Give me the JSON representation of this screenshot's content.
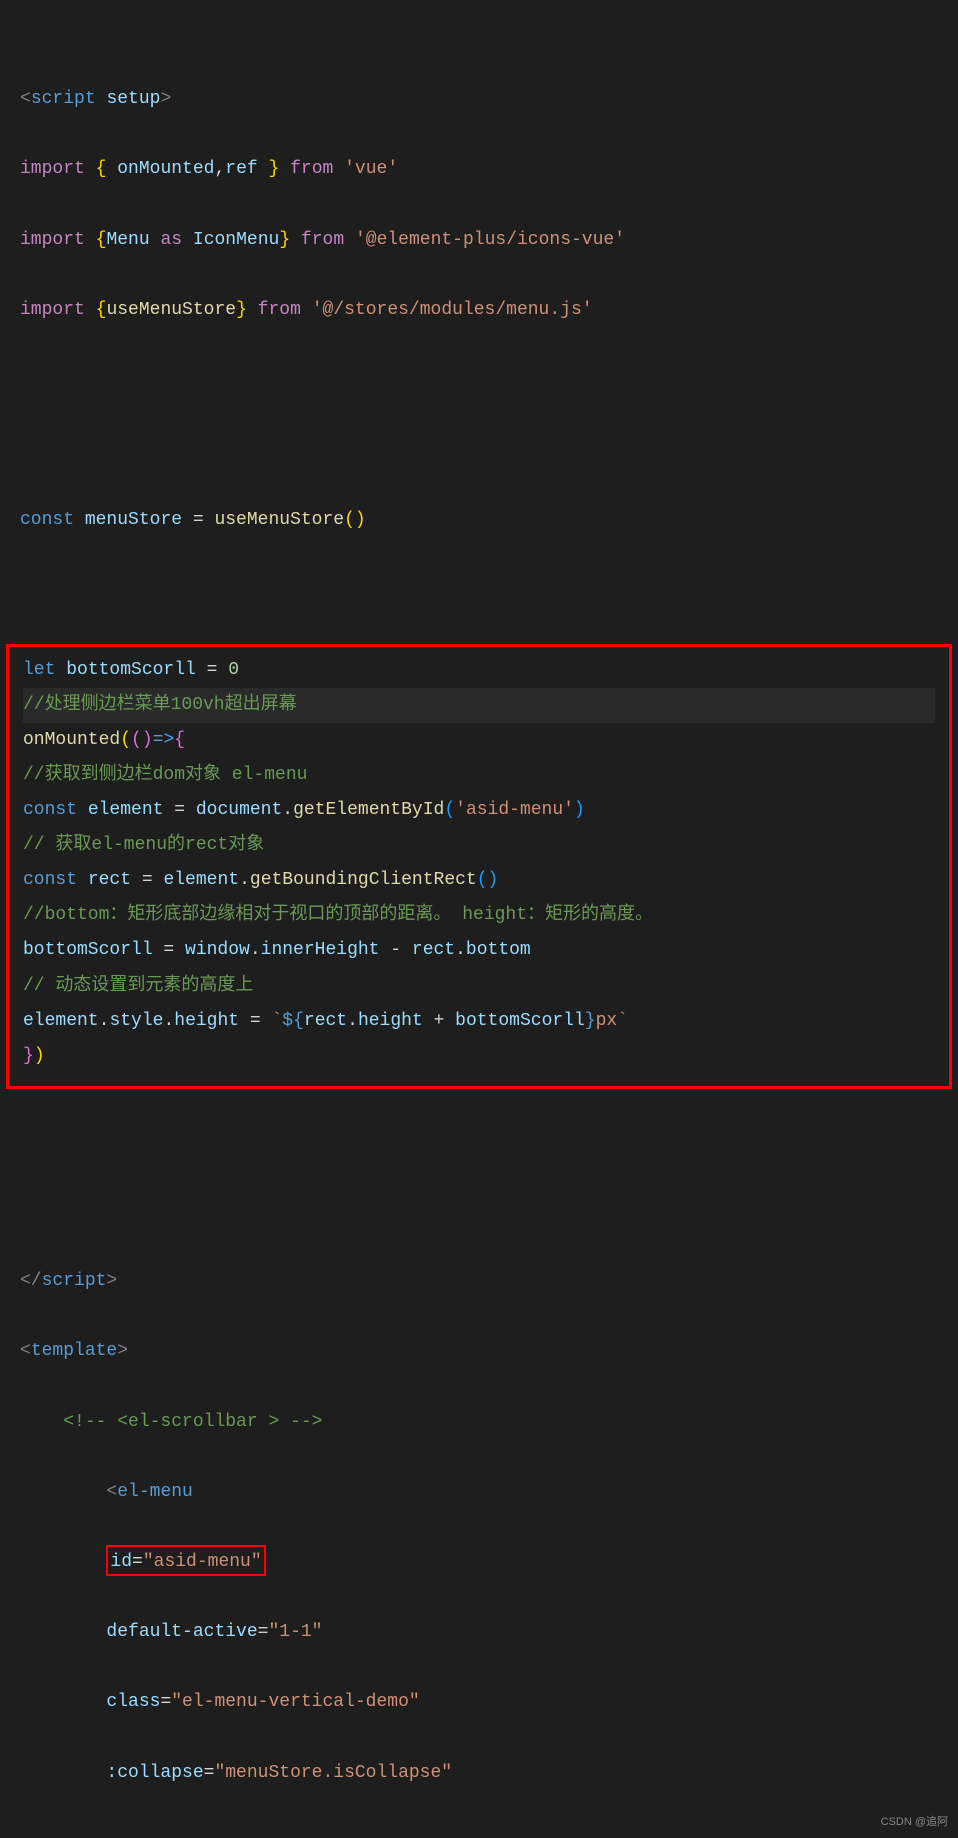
{
  "l1": {
    "open": "<",
    "tag": "script",
    "attr": "setup",
    "close": ">"
  },
  "l2": {
    "imp": "import",
    "lb": "{ ",
    "a": "onMounted",
    "c": ",",
    "b": "ref",
    "rb": " }",
    "from": "from",
    "str": "'vue'"
  },
  "l3": {
    "imp": "import",
    "lb": "{",
    "a": "Menu",
    "as": "as",
    "b": "IconMenu",
    "rb": "}",
    "from": "from",
    "str": "'@element-plus/icons-vue'"
  },
  "l4": {
    "imp": "import",
    "lb": "{",
    "a": "useMenuStore",
    "rb": "}",
    "from": "from",
    "str": "'@/stores/modules/menu.js'"
  },
  "l5": {
    "kw": "const",
    "name": "menuStore",
    "eq": " = ",
    "fn": "useMenuStore",
    "p": "()"
  },
  "l6": {
    "kw": "let",
    "name": "bottomScorll",
    "eq": " = ",
    "val": "0"
  },
  "l7": {
    "c": "//处理侧边栏菜单100vh超出屏幕"
  },
  "l8": {
    "fn": "onMounted",
    "lp": "(",
    "ar1": "(",
    "ar2": ")",
    "arrow": "=>",
    "lb": "{"
  },
  "l9": {
    "c": "//获取到侧边栏dom对象 el-menu"
  },
  "l10": {
    "kw": "const",
    "name": "element",
    "eq": " = ",
    "obj": "document",
    "dot": ".",
    "fn": "getElementById",
    "lp": "(",
    "str": "'asid-menu'",
    "rp": ")"
  },
  "l11": {
    "c": "// 获取el-menu的rect对象"
  },
  "l12": {
    "kw": "const",
    "name": "rect",
    "eq": " = ",
    "obj": "element",
    "dot": ".",
    "fn": "getBoundingClientRect",
    "lp": "(",
    "rp": ")"
  },
  "l13": {
    "c": "//bottom：矩形底部边缘相对于视口的顶部的距离。 height：矩形的高度。"
  },
  "l14": {
    "a": "bottomScorll",
    "eq": " = ",
    "b": "window",
    "dot": ".",
    "c": "innerHeight",
    "op": " - ",
    "d": "rect",
    "dot2": ".",
    "e": "bottom"
  },
  "l15": {
    "c": "// 动态设置到元素的高度上"
  },
  "l16": {
    "a": "element",
    "d1": ".",
    "b": "style",
    "d2": ".",
    "c": "height",
    "eq": " = ",
    "bt1": "`",
    "dl": "${",
    "r": "rect",
    "d3": ".",
    "h": "height",
    "op": " + ",
    "bs": "bottomScorll",
    "dr": "}",
    "px": "px",
    "bt2": "`"
  },
  "l17": {
    "rb": "}",
    "rp": ")"
  },
  "l18": {
    "open": "</",
    "tag": "script",
    "close": ">"
  },
  "l19": {
    "open": "<",
    "tag": "template",
    "close": ">"
  },
  "l20": {
    "c": "<!-- <el-scrollbar > -->"
  },
  "l21": {
    "open": "<",
    "tag": "el-menu"
  },
  "l22": {
    "attr": "id",
    "eq": "=",
    "str": "\"asid-menu\""
  },
  "l23": {
    "attr": "default-active",
    "eq": "=",
    "str": "\"1-1\""
  },
  "l24": {
    "attr": "class",
    "eq": "=",
    "str": "\"el-menu-vertical-demo\""
  },
  "l25": {
    "attr": ":collapse",
    "eq": "=",
    "str": "\"menuStore.isCollapse\""
  },
  "watermark": "CSDN @追阿"
}
